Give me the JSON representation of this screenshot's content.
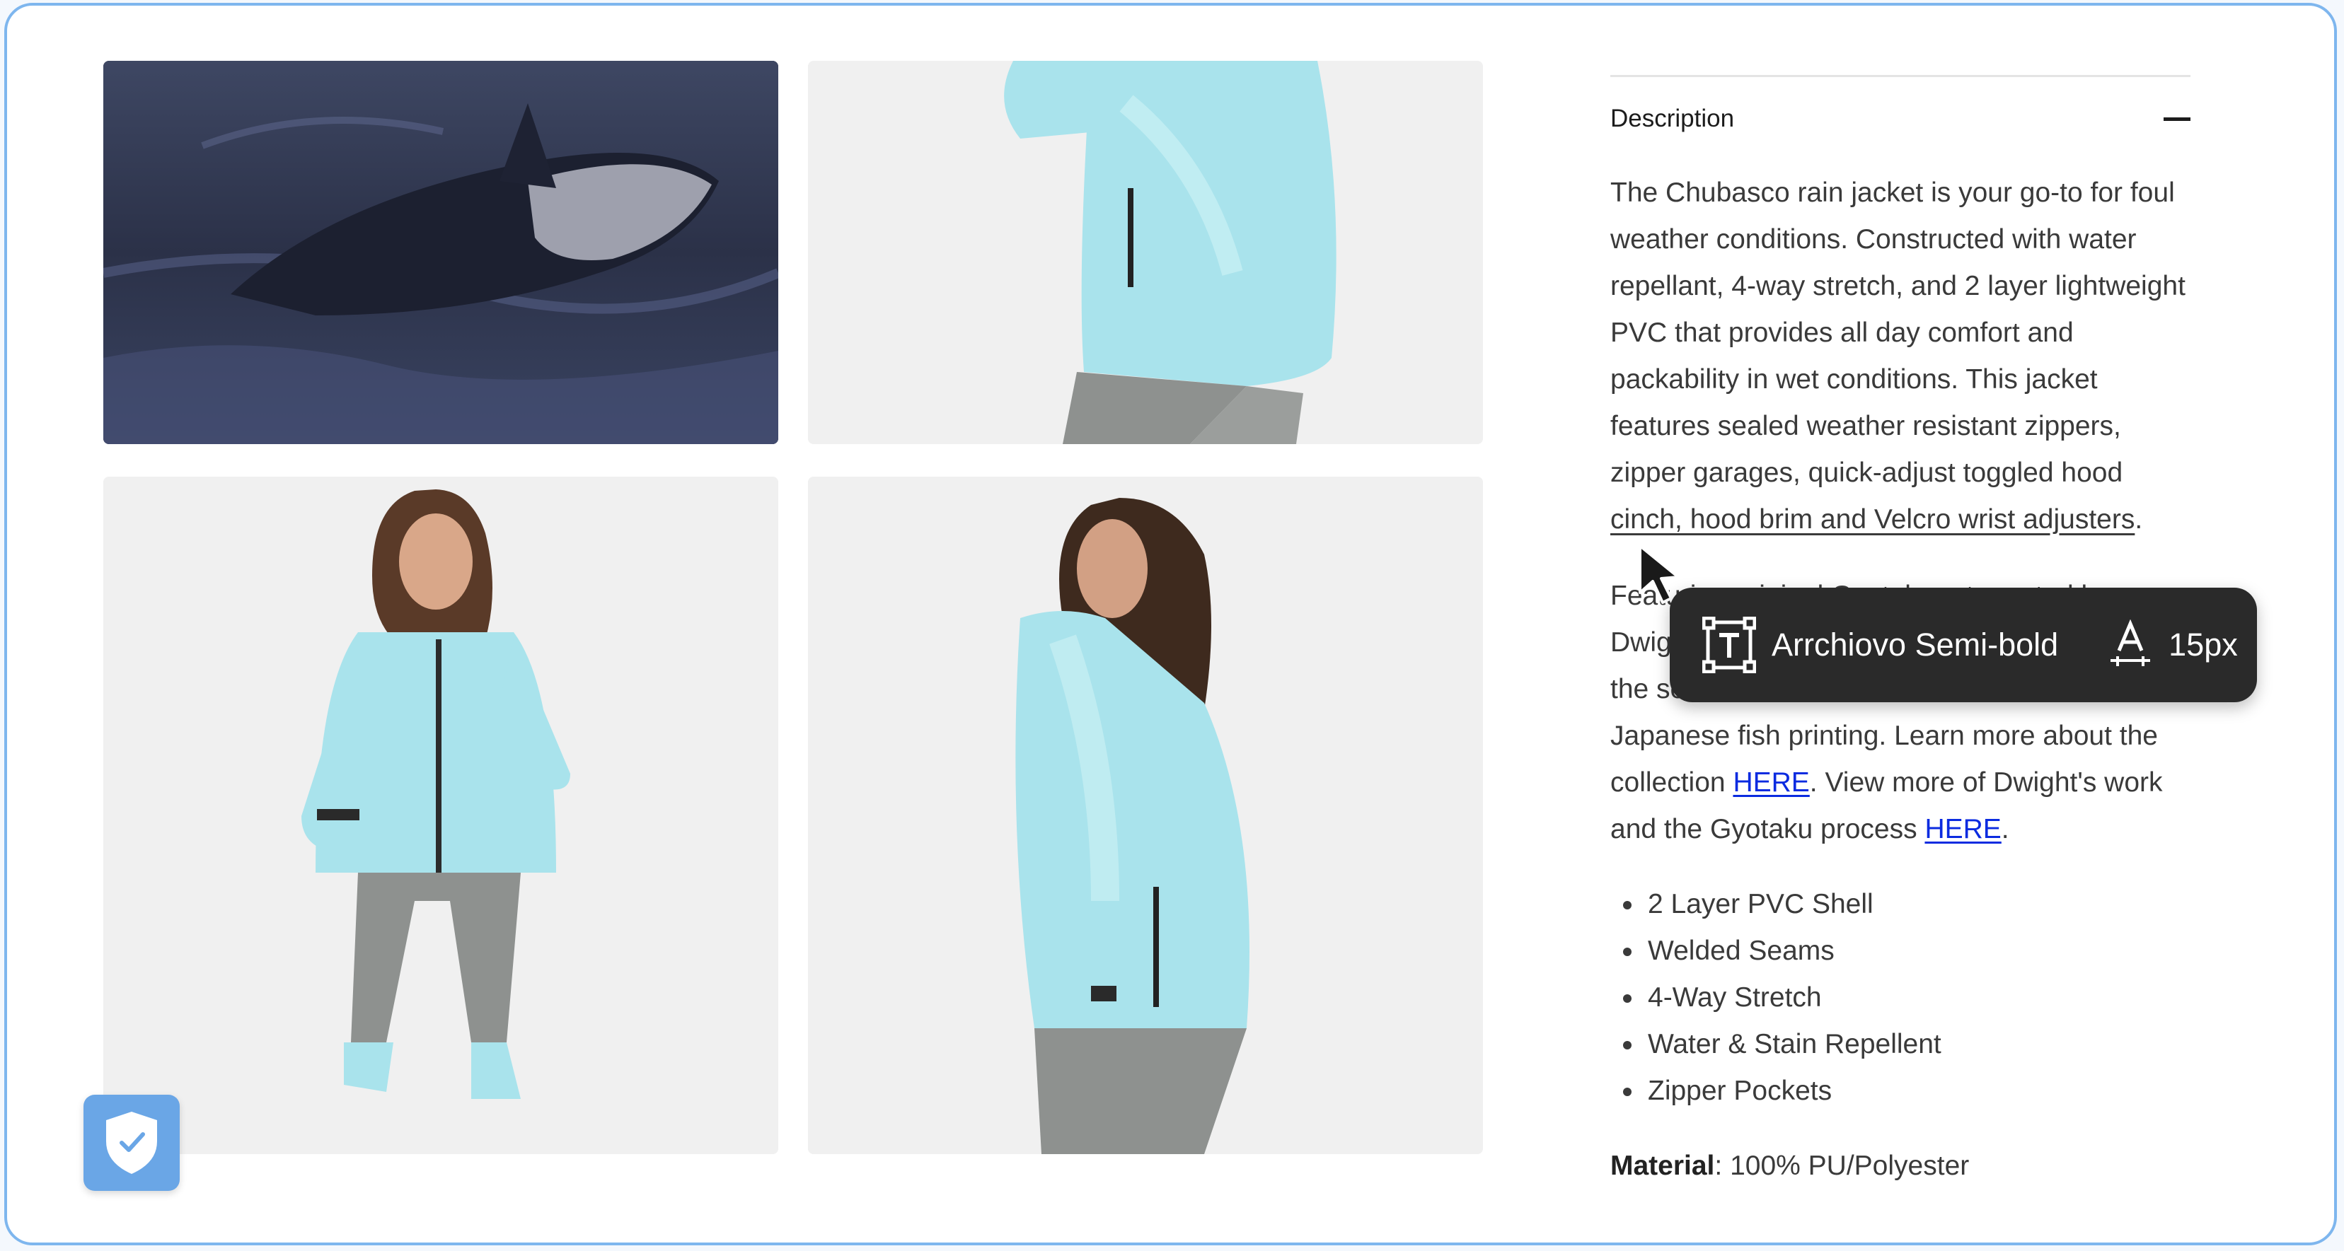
{
  "description": {
    "header": "Description",
    "paragraph1": "The Chubasco rain jacket is your go-to for foul weather conditions. Constructed with water repellant, 4-way stretch, and 2 layer lightweight PVC that provides all day comfort and packability in wet conditions. This jacket features sealed weather resistant zippers, zipper garages, quick-adjust toggled hood ",
    "paragraph1_underlined": "cinch, hood brim and Velcro wrist adjusters",
    "paragraph1_end": ".",
    "paragraph2_line1": "Featuring original Gyotaku art created by",
    "paragraph2_line2": "Dwight",
    "paragraph2_line3": "the se",
    "paragraph2_line4": "Japanese fish printing. Learn more about the",
    "paragraph2_collection_prefix": "collection ",
    "link_collection": "HERE",
    "paragraph2_mid": ". View more of Dwight's work",
    "paragraph2_process_prefix": "and the Gyotaku process ",
    "link_process": "HERE",
    "paragraph2_end": "."
  },
  "features": [
    "2 Layer PVC Shell",
    "Welded Seams",
    "4-Way Stretch",
    "Water & Stain Repellent",
    "Zipper Pockets"
  ],
  "material": {
    "label": "Material",
    "value": ": 100% PU/Polyester"
  },
  "tooltip": {
    "font_name": "Arrchiovo Semi-bold",
    "font_size": "15px",
    "font_icon": "text-box-icon",
    "size_icon": "font-size-icon"
  },
  "colors": {
    "frame_border": "#7eb6ee",
    "tooltip_bg": "#2a2a2a",
    "link": "#0b2be0",
    "shield_button": "#6aa6e6",
    "jacket": "#a9e3ec"
  }
}
